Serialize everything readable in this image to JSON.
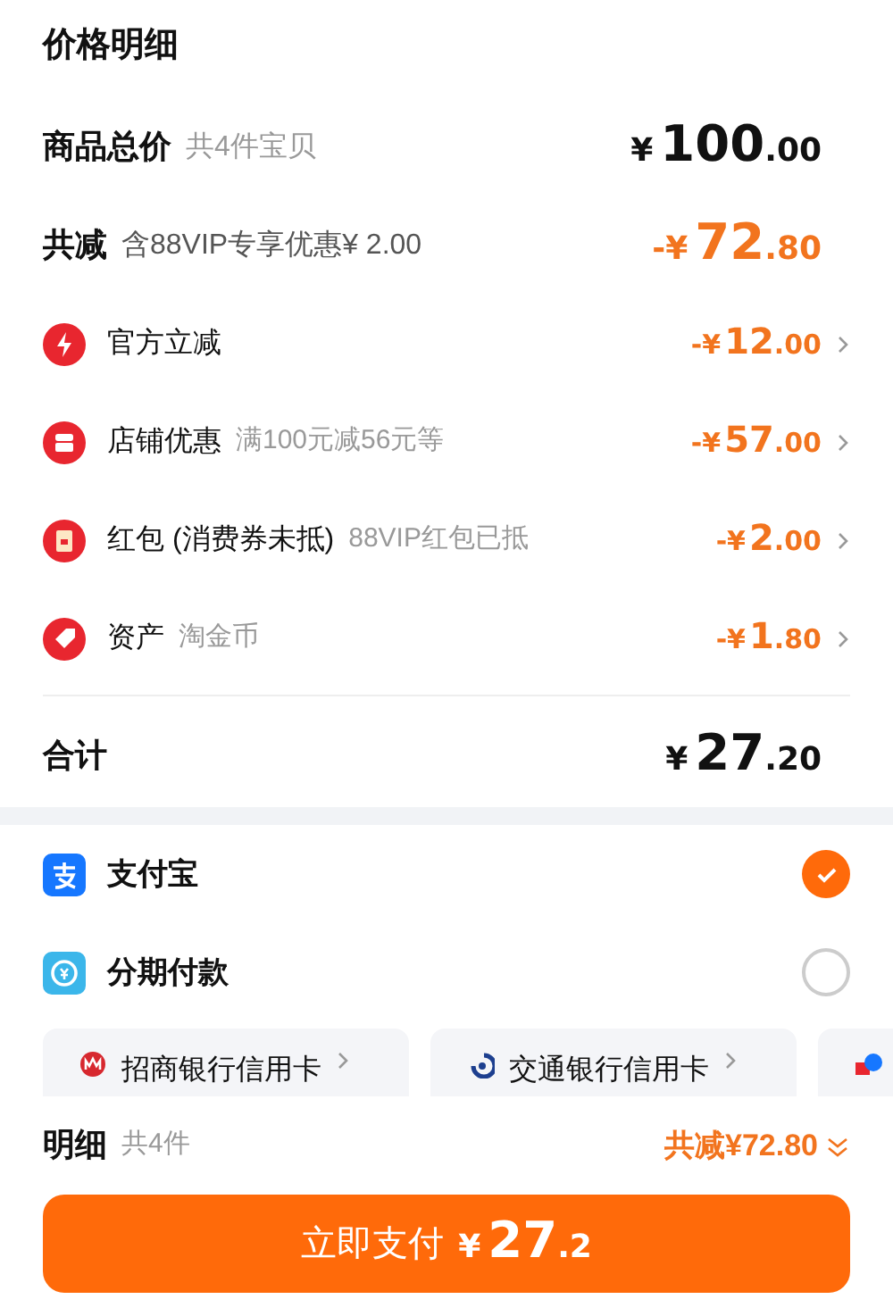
{
  "title": "价格明细",
  "summary": [
    {
      "kind": "total",
      "label": "商品总价",
      "note": "共4件宝贝",
      "price": {
        "prefix": "¥",
        "int": "100",
        "dec": ".00"
      }
    },
    {
      "kind": "discount",
      "label": "共减",
      "note": "含88VIP专享优惠¥ 2.00",
      "price": {
        "prefix": "-¥",
        "int": "72",
        "dec": ".80"
      }
    }
  ],
  "discounts": [
    {
      "kind": "bolt",
      "label": "官方立减",
      "price": {
        "prefix": "-¥",
        "int": "12",
        "dec": ".00"
      }
    },
    {
      "kind": "store",
      "label": "店铺优惠",
      "note": "满100元减56元等",
      "price": {
        "prefix": "-¥",
        "int": "57",
        "dec": ".00"
      }
    },
    {
      "kind": "envelope",
      "label": "红包 (消费券未抵)",
      "note": "88VIP红包已抵",
      "price": {
        "prefix": "-¥",
        "int": "2",
        "dec": ".00"
      }
    },
    {
      "kind": "tag",
      "label": "资产",
      "note": "淘金币",
      "price": {
        "prefix": "-¥",
        "int": "1",
        "dec": ".80"
      }
    }
  ],
  "sum": {
    "label": "合计",
    "price": {
      "prefix": "¥",
      "int": "27",
      "dec": ".20"
    }
  },
  "payment_methods": [
    {
      "kind": "alipay",
      "label": "支付宝",
      "selected": true
    },
    {
      "kind": "installment",
      "label": "分期付款",
      "selected": false
    }
  ],
  "cards": [
    {
      "kind": "cmb",
      "label": "招商银行信用卡"
    },
    {
      "kind": "bocom",
      "label": "交通银行信用卡"
    },
    {
      "kind": "other"
    }
  ],
  "footer": {
    "label": "明细",
    "count": "共4件",
    "saving": "共减¥72.80",
    "button": {
      "label": "立即支付",
      "price": {
        "prefix": "¥",
        "int": "27",
        "dec": ".2"
      }
    }
  }
}
